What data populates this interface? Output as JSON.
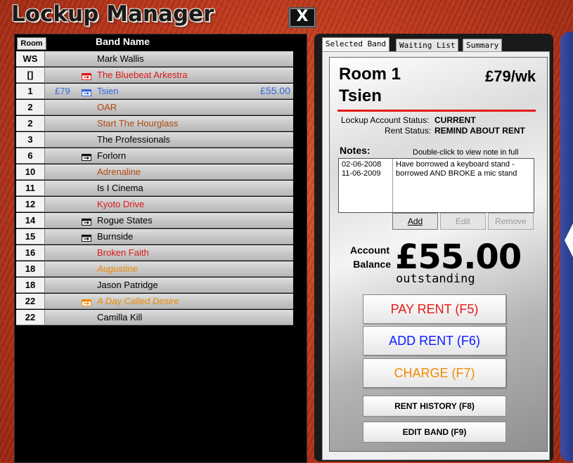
{
  "app": {
    "title": "Lockup Manager",
    "close_label": "X"
  },
  "list": {
    "header_room": "Room",
    "header_band": "Band Name",
    "rows": [
      {
        "room": "WS",
        "rent": "",
        "flag": "",
        "name": "Mark Wallis",
        "balance": "",
        "color": "#000000",
        "italic": false
      },
      {
        "room": "[]",
        "rent": "",
        "flag": "red",
        "name": "The Bluebeat Arkestra",
        "balance": "",
        "color": "#dd1a1a",
        "italic": false
      },
      {
        "room": "1",
        "rent": "£79",
        "flag": "blue",
        "name": "Tsien",
        "balance": "£55.00",
        "color": "#3366dd",
        "italic": false
      },
      {
        "room": "2",
        "rent": "",
        "flag": "",
        "name": "OAR",
        "balance": "",
        "color": "#b04a10",
        "italic": false
      },
      {
        "room": "2",
        "rent": "",
        "flag": "",
        "name": "Start The Hourglass",
        "balance": "",
        "color": "#b04a10",
        "italic": false
      },
      {
        "room": "3",
        "rent": "",
        "flag": "",
        "name": "The Professionals",
        "balance": "",
        "color": "#000000",
        "italic": false
      },
      {
        "room": "6",
        "rent": "",
        "flag": "black",
        "name": "Forlorn",
        "balance": "",
        "color": "#000000",
        "italic": false
      },
      {
        "room": "10",
        "rent": "",
        "flag": "",
        "name": "Adrenaline",
        "balance": "",
        "color": "#b04a10",
        "italic": false
      },
      {
        "room": "11",
        "rent": "",
        "flag": "",
        "name": "Is I Cinema",
        "balance": "",
        "color": "#000000",
        "italic": false
      },
      {
        "room": "12",
        "rent": "",
        "flag": "",
        "name": "Kyoto Drive",
        "balance": "",
        "color": "#dd1a1a",
        "italic": false
      },
      {
        "room": "14",
        "rent": "",
        "flag": "black",
        "name": "Rogue States",
        "balance": "",
        "color": "#000000",
        "italic": false
      },
      {
        "room": "15",
        "rent": "",
        "flag": "black",
        "name": "Burnside",
        "balance": "",
        "color": "#000000",
        "italic": false
      },
      {
        "room": "16",
        "rent": "",
        "flag": "",
        "name": "Broken Faith",
        "balance": "",
        "color": "#dd1a1a",
        "italic": false
      },
      {
        "room": "18",
        "rent": "",
        "flag": "",
        "name": "Augustine",
        "balance": "",
        "color": "#f08a00",
        "italic": true
      },
      {
        "room": "18",
        "rent": "",
        "flag": "",
        "name": "Jason Patridge",
        "balance": "",
        "color": "#000000",
        "italic": false
      },
      {
        "room": "22",
        "rent": "",
        "flag": "orange",
        "name": "A Day Called Desire",
        "balance": "",
        "color": "#f08a00",
        "italic": true
      },
      {
        "room": "22",
        "rent": "",
        "flag": "",
        "name": "Camilla Kill",
        "balance": "",
        "color": "#000000",
        "italic": false
      }
    ]
  },
  "tabs": [
    {
      "label": "Selected Band",
      "active": true
    },
    {
      "label": "Waiting List",
      "active": false
    },
    {
      "label": "Summary",
      "active": false
    }
  ],
  "detail": {
    "room": "Room 1",
    "band": "Tsien",
    "price": "£79/wk",
    "account_status_label": "Lockup Account Status:",
    "account_status_value": "CURRENT",
    "rent_status_label": "Rent Status:",
    "rent_status_value": "REMIND ABOUT RENT",
    "notes_label": "Notes:",
    "notes_hint": "Double-click to view note in full",
    "notes": [
      {
        "date": "02-06-2008",
        "text": "Have borrowed a keyboard stand -"
      },
      {
        "date": "11-06-2009",
        "text": "borrowed AND BROKE a mic stand"
      }
    ],
    "note_buttons": {
      "add": "Add",
      "edit": "Edit",
      "remove": "Remove"
    },
    "balance_label_1": "Account",
    "balance_label_2": "Balance",
    "balance_amount": "£55.00",
    "balance_state": "outstanding",
    "buttons": {
      "pay": "PAY RENT (F5)",
      "add_rent": "ADD RENT (F6)",
      "charge": "CHARGE (F7)",
      "history": "RENT HISTORY (F8)",
      "edit_band": "EDIT BAND (F9)"
    }
  },
  "colors": {
    "pay": "#e41b17",
    "add_rent": "#0a1aff",
    "charge": "#f08a00",
    "accent_red": "#e41b17"
  }
}
